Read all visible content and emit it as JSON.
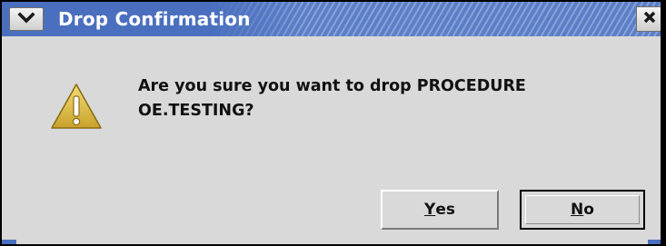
{
  "window": {
    "title": "Drop Confirmation",
    "menu_icon": "chevron-down-icon",
    "close_icon": "close-icon"
  },
  "dialog": {
    "icon": "warning-icon",
    "message_line1": "Are you sure you want to drop PROCEDURE",
    "message_line2": "OE.TESTING?"
  },
  "buttons": {
    "yes_mnemonic": "Y",
    "yes_rest": "es",
    "no_mnemonic": "N",
    "no_rest": "o"
  },
  "colors": {
    "titlebar": "#5b7ec7",
    "dialog_bg": "#d9d9d9",
    "warning_fill": "#e2c04a",
    "text": "#111111"
  }
}
